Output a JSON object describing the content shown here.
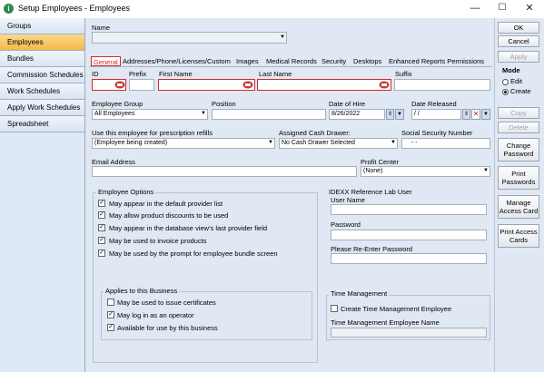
{
  "window": {
    "title": "Setup Employees - Employees",
    "min": "—",
    "max": "☐",
    "close": "✕"
  },
  "sidebar": {
    "items": [
      {
        "label": "Groups"
      },
      {
        "label": "Employees"
      },
      {
        "label": "Bundles"
      },
      {
        "label": "Commission Schedules"
      },
      {
        "label": "Work Schedules"
      },
      {
        "label": "Apply Work Schedules"
      },
      {
        "label": "Spreadsheet"
      }
    ]
  },
  "name": {
    "label": "Name",
    "value": ""
  },
  "tabs": [
    "General",
    "Addresses/Phone/Licenses/Custom",
    "Images",
    "Medical Records",
    "Security",
    "Desktops",
    "Enhanced Reports Permissions"
  ],
  "fields": {
    "id": {
      "label": "ID",
      "value": ""
    },
    "prefix": {
      "label": "Prefix",
      "value": ""
    },
    "first_name": {
      "label": "First Name",
      "value": ""
    },
    "last_name": {
      "label": "Last Name",
      "value": ""
    },
    "suffix": {
      "label": "Suffix",
      "value": ""
    },
    "employee_group": {
      "label": "Employee Group",
      "value": "All Employees"
    },
    "position": {
      "label": "Position",
      "value": ""
    },
    "date_of_hire": {
      "label": "Date of Hire",
      "value": "8/26/2022"
    },
    "date_released": {
      "label": "Date Released",
      "value": "  /  /"
    },
    "prescription": {
      "label": "Use this employee for prescription refills",
      "value": "(Employee being created)"
    },
    "cash_drawer": {
      "label": "Assigned Cash Drawer:",
      "value": "No Cash Drawer Selected"
    },
    "ssn": {
      "label": "Social Security Number",
      "value": "-   -"
    },
    "email": {
      "label": "Email Address",
      "value": ""
    },
    "profit_center": {
      "label": "Profit Center",
      "value": "(None)"
    }
  },
  "employee_options": {
    "title": "Employee Options",
    "items": [
      {
        "label": "May appear in the default provider list",
        "checked": true
      },
      {
        "label": "May allow product discounts to be used",
        "checked": true
      },
      {
        "label": "May appear in the database view's last provider field",
        "checked": true
      },
      {
        "label": "May be used to invoice products",
        "checked": true
      },
      {
        "label": "May be used by the prompt for employee bundle screen",
        "checked": true
      }
    ]
  },
  "business": {
    "title": "Applies to this Business",
    "items": [
      {
        "label": "May be used to issue certificates",
        "checked": false
      },
      {
        "label": "May log in as an operator",
        "checked": true
      },
      {
        "label": "Available for use by this business",
        "checked": true
      }
    ]
  },
  "idexx": {
    "title": "IDEXX Reference Lab User",
    "user_name": "User Name",
    "password": "Password",
    "reenter": "Please Re-Enter Password"
  },
  "time_mgmt": {
    "title": "Time Management",
    "create_label": "Create Time Management Employee",
    "name_label": "Time Management Employee Name"
  },
  "right": {
    "ok": "OK",
    "cancel": "Cancel",
    "apply": "Apply",
    "mode": "Mode",
    "edit": "Edit",
    "create": "Create",
    "copy": "Copy",
    "delete": "Delete",
    "change_password": "Change Password",
    "print_passwords": "Print Passwords",
    "manage_access_card": "Manage Access Card",
    "print_access_cards": "Print Access Cards"
  },
  "colors": {
    "accent_active": "#f5b84a",
    "required": "#d12a2a"
  }
}
